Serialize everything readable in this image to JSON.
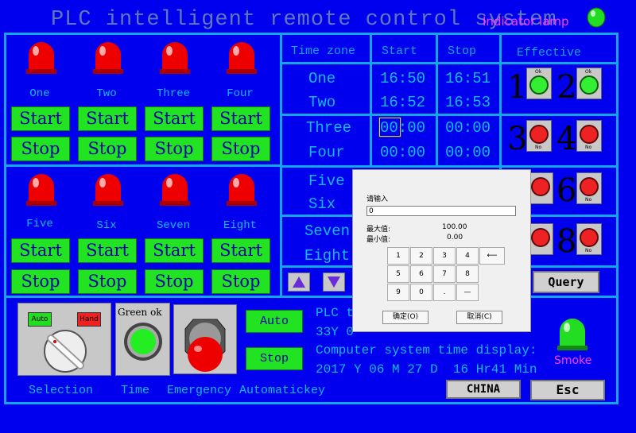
{
  "header": {
    "title": "PLC intelligent remote control system",
    "indicator_label": "Indicator lamp"
  },
  "lamps_top": [
    {
      "label": "One"
    },
    {
      "label": "Two"
    },
    {
      "label": "Three"
    },
    {
      "label": "Four"
    }
  ],
  "lamps_bottom": [
    {
      "label": "Five"
    },
    {
      "label": "Six"
    },
    {
      "label": "Seven"
    },
    {
      "label": "Eight"
    }
  ],
  "buttons": {
    "start": "Start",
    "stop": "Stop"
  },
  "table": {
    "headers": [
      "Time zone",
      "Start",
      "Stop",
      "Effective"
    ],
    "rows": [
      {
        "zone": "One",
        "start": "16:50",
        "stop": "16:51"
      },
      {
        "zone": "Two",
        "start": "16:52",
        "stop": "16:53"
      },
      {
        "zone": "Three",
        "start": "00:00",
        "stop": "00:00"
      },
      {
        "zone": "Four",
        "start": "00:00",
        "stop": "00:00"
      },
      {
        "zone": "Five"
      },
      {
        "zone": "Six"
      },
      {
        "zone": "Seven"
      },
      {
        "zone": "Eight"
      }
    ],
    "effective": [
      {
        "num": "1",
        "btn": "Ok",
        "state": "on"
      },
      {
        "num": "2",
        "btn": "Ok",
        "state": "on"
      },
      {
        "num": "3",
        "btn": "No",
        "state": "off"
      },
      {
        "num": "4",
        "btn": "No",
        "state": "off"
      },
      {
        "num": "6",
        "btn": "No",
        "state": "off"
      },
      {
        "num": "8",
        "btn": "No",
        "state": "off"
      }
    ],
    "query_label": "Query"
  },
  "bottom": {
    "selector_auto": "Auto",
    "selector_hand": "Hand",
    "green_ok": "Green ok",
    "labels": {
      "selection": "Selection",
      "time": "Time",
      "emergency": "Emergency",
      "automatickey": "Automatickey"
    },
    "auto_btn": "Auto",
    "stop_btn": "Stop",
    "info_line1": "PLC t",
    "info_line2": "33Y 0",
    "sys_time_label": "Computer system time display:",
    "sys_time": {
      "year": "2017",
      "y": "Y",
      "month": "06",
      "m": "M",
      "day": "27",
      "d": "D",
      "hour": "16",
      "hr": "Hr",
      "min": "41",
      "min_label": "Min"
    },
    "smoke_label": "Smoke",
    "china_btn": "CHINA",
    "esc_btn": "Esc"
  },
  "dialog": {
    "prompt": "请输入",
    "value": "0",
    "max_label": "最大值:",
    "max_value": "100.00",
    "min_label": "最小值:",
    "min_value": "0.00",
    "keys": [
      "1",
      "2",
      "3",
      "4",
      "⟵",
      "5",
      "6",
      "7",
      "8",
      "9",
      "0",
      ".",
      "—"
    ],
    "ok": "确定(O)",
    "cancel": "取消(C)"
  },
  "colors": {
    "background": "#0000ee",
    "frame": "#11a6ee",
    "button_green": "#22e322",
    "lamp_red": "#ee0000",
    "lamp_green": "#22ee22"
  }
}
